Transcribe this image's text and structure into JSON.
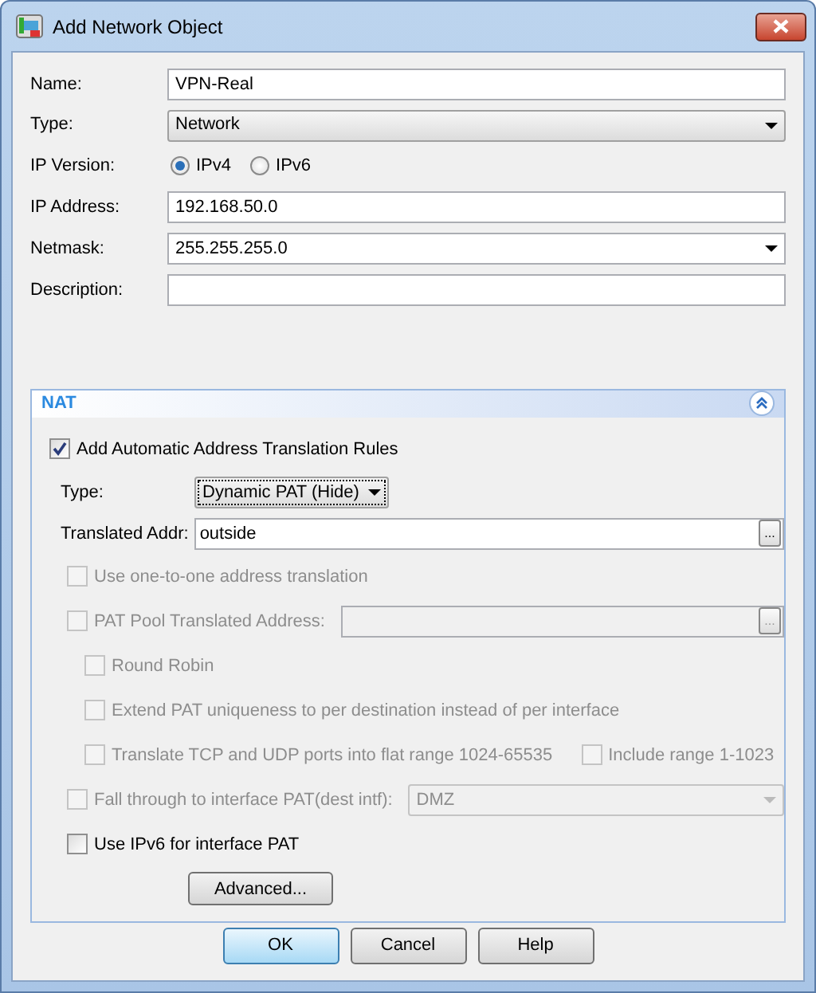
{
  "window": {
    "title": "Add Network Object"
  },
  "fields": [
    {
      "kind": "text",
      "label": "Name:",
      "value": "VPN-Real"
    },
    {
      "kind": "select",
      "label": "Type:",
      "value": "Network"
    },
    {
      "kind": "radio",
      "label": "IP Version:",
      "options": [
        {
          "label": "IPv4",
          "selected": true
        },
        {
          "label": "IPv6",
          "selected": false
        }
      ]
    },
    {
      "kind": "text",
      "label": "IP Address:",
      "value": "192.168.50.0"
    },
    {
      "kind": "combo",
      "label": "Netmask:",
      "value": "255.255.255.0"
    },
    {
      "kind": "text",
      "label": "Description:"
    }
  ],
  "nat": {
    "title": "NAT",
    "expanded": true,
    "add_rules": {
      "label": "Add Automatic Address Translation Rules",
      "checked": true
    },
    "type": {
      "label": "Type:",
      "value": "Dynamic PAT (Hide)"
    },
    "translated_addr": {
      "label": "Translated Addr:",
      "value": "outside",
      "browse": "..."
    },
    "options": [
      {
        "kind": "checkbox",
        "label": "Use one-to-one address translation",
        "checked": false,
        "disabled": true
      },
      {
        "kind": "checkbox_field",
        "label": "PAT Pool Translated Address:",
        "checked": false,
        "disabled": true,
        "browse": "...",
        "children": [
          {
            "kind": "checkbox",
            "label": "Round Robin",
            "checked": false,
            "disabled": true
          },
          {
            "kind": "checkbox",
            "label": "Extend PAT uniqueness to per destination instead of per interface",
            "checked": false,
            "disabled": true
          },
          {
            "kind": "checkbox_pair",
            "label": "Translate TCP and UDP ports into flat range 1024-65535",
            "checked": false,
            "disabled": true,
            "second": {
              "label": "Include range 1-1023",
              "checked": false,
              "disabled": true
            }
          }
        ]
      },
      {
        "kind": "checkbox_select",
        "label": "Fall through to interface PAT(dest intf):",
        "checked": false,
        "disabled": true,
        "value": "DMZ"
      },
      {
        "kind": "checkbox",
        "label": "Use IPv6 for interface PAT",
        "checked": false,
        "disabled": false
      }
    ],
    "advanced_button": "Advanced..."
  },
  "buttons": [
    {
      "label": "OK",
      "default": true
    },
    {
      "label": "Cancel",
      "default": false
    },
    {
      "label": "Help",
      "default": false
    }
  ]
}
